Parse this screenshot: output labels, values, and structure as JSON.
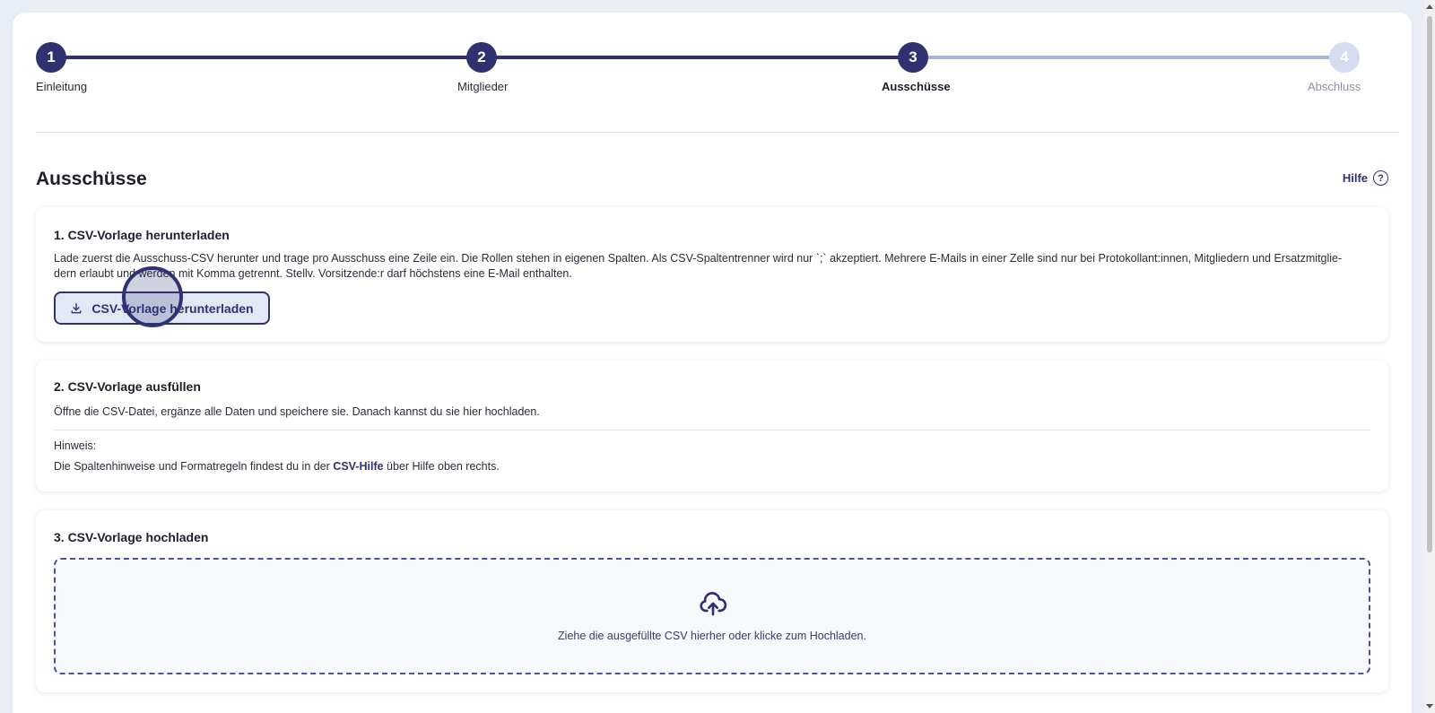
{
  "stepper": {
    "steps": [
      {
        "number": "1",
        "label": "Einleitung"
      },
      {
        "number": "2",
        "label": "Mitglieder"
      },
      {
        "number": "3",
        "label": "Ausschüsse"
      },
      {
        "number": "4",
        "label": "Abschluss"
      }
    ]
  },
  "header": {
    "title": "Ausschüsse",
    "help_label": "Hilfe",
    "help_icon": "?"
  },
  "card_download": {
    "title": "1. CSV-Vorlage herunterladen",
    "text": "Lade zuerst die Ausschuss-CSV herunter und trage pro Ausschuss eine Zeile ein. Die Rollen stehen in eigenen Spalten. Als CSV-Spaltentrenner wird nur `;` akzeptiert. Mehrere E-Mails in einer Zelle sind nur bei Protokollant:innen, Mitgliedern und Ersatzmitglie­dern erlaubt und werden mit Komma getrennt. Stellv. Vorsitzende:r darf höchstens eine E-Mail enthalten.",
    "button_label": "CSV-Vorlage herunterladen"
  },
  "card_fill": {
    "title": "2. CSV-Vorlage ausfüllen",
    "text": "Öffne die CSV-Datei, ergänze alle Daten und speichere sie. Danach kannst du sie hier hochladen.",
    "hint_label": "Hinweis:",
    "hint_prefix": "Die Spaltenhinweise und Formatregeln findest du in der ",
    "hint_link": "CSV-Hilfe",
    "hint_suffix": " über Hilfe oben rechts."
  },
  "card_upload": {
    "title": "3. CSV-Vorlage hochladen",
    "dropzone_text": "Ziehe die ausgefüllte CSV hierher oder klicke zum Hochladen."
  },
  "colors": {
    "primary": "#2f3270",
    "step_todo": "#d5dcef",
    "line_todo": "#a9b4d6"
  },
  "icons": {
    "download": "download-icon",
    "upload": "cloud-upload-icon",
    "help": "help-circle-icon"
  }
}
